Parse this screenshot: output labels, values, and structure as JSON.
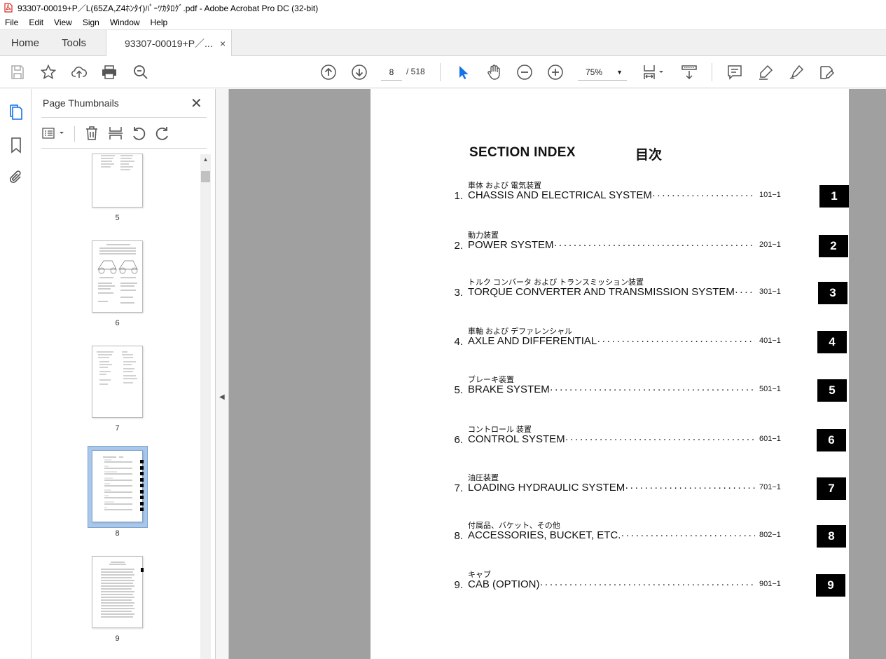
{
  "window": {
    "title": "93307-00019+P／L(65ZA,Z4ﾎﾝﾀｲ)ﾊﾟｰﾂｶﾀﾛｸﾞ.pdf - Adobe Acrobat Pro DC (32-bit)"
  },
  "menu": [
    "File",
    "Edit",
    "View",
    "Sign",
    "Window",
    "Help"
  ],
  "tabs": {
    "home": "Home",
    "tools": "Tools",
    "document": "93307-00019+P／...",
    "close": "×"
  },
  "toolbar": {
    "page_current": "8",
    "page_total": "/ 518",
    "zoom": "75%",
    "zoom_chevron": "▼"
  },
  "panel": {
    "title": "Page Thumbnails",
    "close": "✕",
    "thumbnails": [
      {
        "label": "5"
      },
      {
        "label": "6"
      },
      {
        "label": "7"
      },
      {
        "label": "8",
        "selected": true
      },
      {
        "label": "9"
      }
    ]
  },
  "document": {
    "heading": "SECTION INDEX",
    "heading_jp": "目次",
    "entries": [
      {
        "jp": "車体 および 電気装置",
        "num": "1.",
        "title": "CHASSIS AND ELECTRICAL SYSTEM",
        "page": "101−1",
        "tab": "1"
      },
      {
        "jp": "動力装置",
        "num": "2.",
        "title": "POWER SYSTEM",
        "page": "201−1",
        "tab": "2"
      },
      {
        "jp": "トルク コンバータ および トランスミッション装置",
        "num": "3.",
        "title": "TORQUE CONVERTER AND TRANSMISSION SYSTEM",
        "page": "301−1",
        "tab": "3"
      },
      {
        "jp": "車軸 および デファレンシャル",
        "num": "4.",
        "title": "AXLE AND DIFFERENTIAL",
        "page": "401−1",
        "tab": "4"
      },
      {
        "jp": "ブレーキ装置",
        "num": "5.",
        "title": "BRAKE SYSTEM",
        "page": "501−1",
        "tab": "5"
      },
      {
        "jp": "コントロール 装置",
        "num": "6.",
        "title": "CONTROL SYSTEM",
        "page": "601−1",
        "tab": "6"
      },
      {
        "jp": "油圧装置",
        "num": "7.",
        "title": "LOADING HYDRAULIC SYSTEM",
        "page": "701−1",
        "tab": "7"
      },
      {
        "jp": "付属品、バケット、その他",
        "num": "8.",
        "title": "ACCESSORIES, BUCKET, ETC.",
        "page": "802−1",
        "tab": "8"
      },
      {
        "jp": "キャブ",
        "num": "9.",
        "title": "CAB (OPTION)",
        "page": "901−1",
        "tab": "9"
      }
    ]
  },
  "colors": {
    "accent": "#1473e6",
    "viewer_bg": "#a0a0a0",
    "selected_thumb": "#a9c7e8"
  }
}
